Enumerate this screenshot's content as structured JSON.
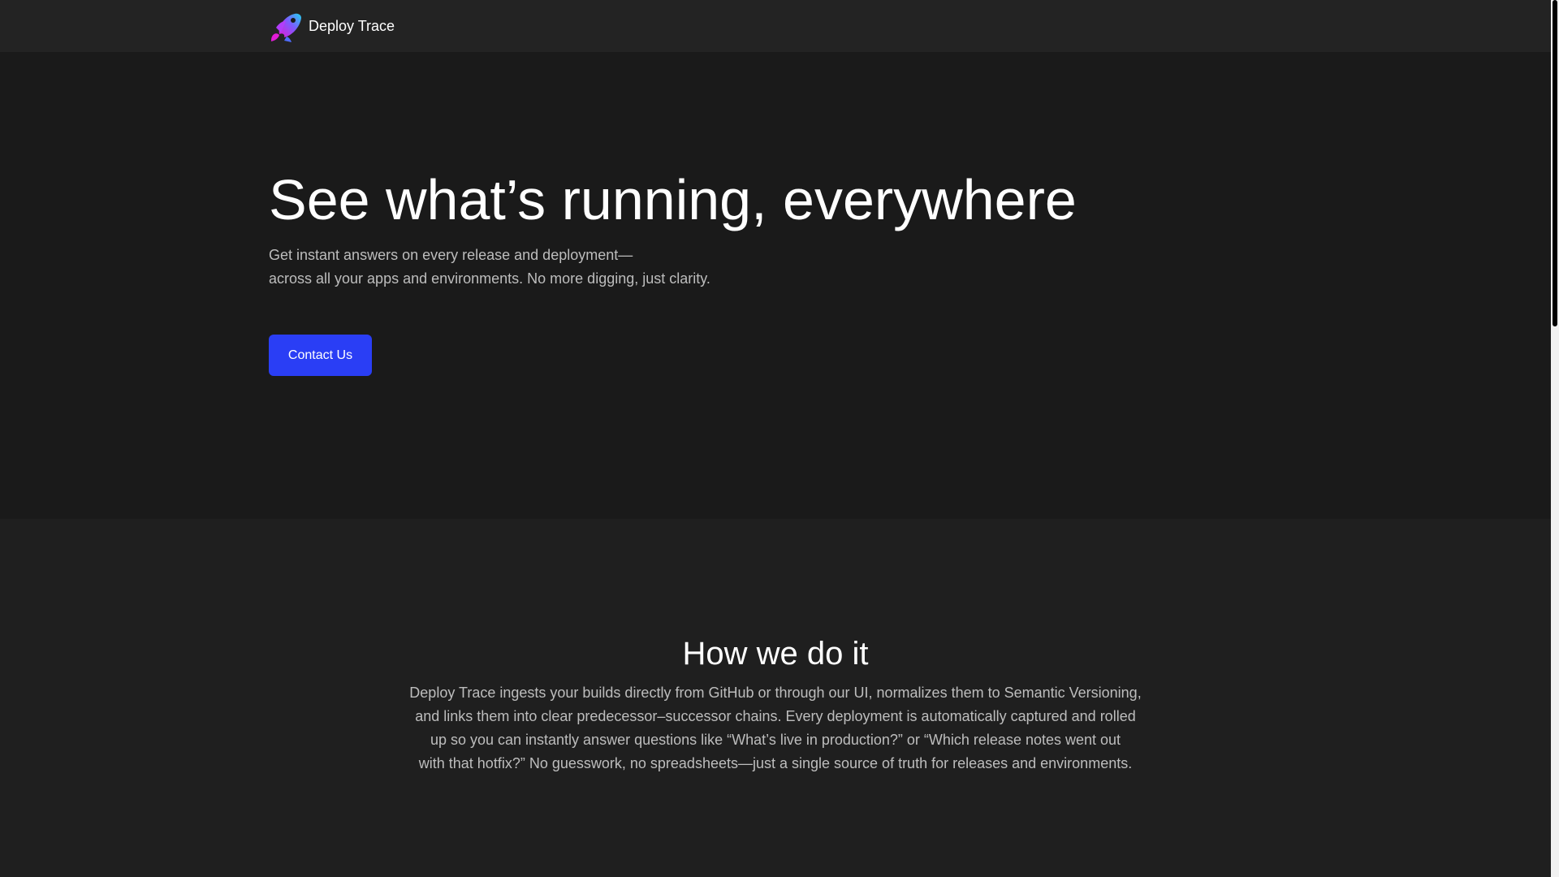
{
  "navbar": {
    "brand_name": "Deploy Trace",
    "logo_icon": "rocket-logo-icon"
  },
  "hero": {
    "title": "See what’s running, everywhere",
    "subtitle_lines": [
      "Get instant answers on every release and deployment—",
      "across all your apps and environments. No more digging, just clarity."
    ],
    "cta_label": "Contact Us"
  },
  "how": {
    "title": "How we do it",
    "body_lines": [
      "Deploy Trace ingests your builds directly from GitHub or through our UI, normalizes them to Semantic Versioning,",
      "and links them into clear predecessor–successor chains. Every deployment is automatically captured and rolled",
      "up so you can instantly answer questions like “What’s live in production?” or “Which release notes went out",
      "with that hotfix?” No guesswork, no spreadsheets—just a single source of truth for releases and environments."
    ]
  },
  "colors": {
    "page_bg": "#1a1a1a",
    "navbar_bg": "#232323",
    "section_bg": "#1f1f1f",
    "accent": "#2a3ef5",
    "text_primary": "#ffffff",
    "text_muted": "#bdbdbd"
  }
}
